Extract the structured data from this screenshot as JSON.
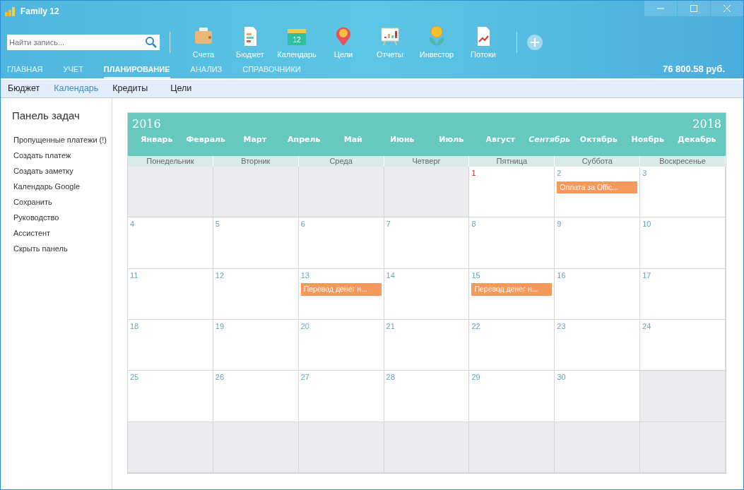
{
  "window": {
    "title": "Family 12"
  },
  "search": {
    "placeholder": "Найти запись..."
  },
  "toolbar": [
    {
      "label": "Счета",
      "kind": "wallet"
    },
    {
      "label": "Бюджет",
      "kind": "budget"
    },
    {
      "label": "Календарь",
      "kind": "calendar",
      "badge": "12"
    },
    {
      "label": "Цели",
      "kind": "goal"
    },
    {
      "label": "Отчеты",
      "kind": "reports"
    },
    {
      "label": "Инвестор",
      "kind": "investor"
    },
    {
      "label": "Потоки",
      "kind": "flows"
    }
  ],
  "main_tabs": [
    {
      "label": "ГЛАВНАЯ",
      "selected": false
    },
    {
      "label": "УЧЕТ",
      "selected": false
    },
    {
      "label": "ПЛАНИРОВАНИЕ",
      "selected": true
    },
    {
      "label": "АНАЛИЗ",
      "selected": false
    },
    {
      "label": "СПРАВОЧНИКИ",
      "selected": false
    }
  ],
  "balance": "76 800.58 руб.",
  "sub_tabs": [
    {
      "label": "Бюджет",
      "selected": false
    },
    {
      "label": "Календарь",
      "selected": true
    },
    {
      "label": "Кредиты",
      "selected": false
    },
    {
      "label": "Цели",
      "selected": false
    }
  ],
  "task_panel": {
    "title": "Панель задач",
    "items": [
      "Пропущенные платежи (!)",
      "Создать платеж",
      "Создать заметку",
      "Календарь Google",
      "Сохранить",
      "Руководство",
      "Ассистент",
      "Скрыть панель"
    ]
  },
  "calendar": {
    "year_prev": "2016",
    "year_next": "2018",
    "months": [
      {
        "label": "Январь",
        "selected": false
      },
      {
        "label": "Февраль",
        "selected": false
      },
      {
        "label": "Март",
        "selected": false
      },
      {
        "label": "Апрель",
        "selected": false
      },
      {
        "label": "Май",
        "selected": false
      },
      {
        "label": "Июнь",
        "selected": false
      },
      {
        "label": "Июль",
        "selected": false
      },
      {
        "label": "Август",
        "selected": false
      },
      {
        "label": "Сентябрь",
        "selected": true
      },
      {
        "label": "Октябрь",
        "selected": false
      },
      {
        "label": "Ноябрь",
        "selected": false
      },
      {
        "label": "Декабрь",
        "selected": false
      }
    ],
    "weekdays": [
      "Понедельник",
      "Вторник",
      "Среда",
      "Четверг",
      "Пятница",
      "Суббота",
      "Воскресенье"
    ],
    "weeks": [
      [
        {
          "in_month": false
        },
        {
          "in_month": false
        },
        {
          "in_month": false
        },
        {
          "in_month": false
        },
        {
          "in_month": true,
          "day": "1",
          "today": true
        },
        {
          "in_month": true,
          "day": "2",
          "today": false,
          "events": [
            "Оплата за Offic..."
          ]
        },
        {
          "in_month": true,
          "day": "3",
          "today": false
        }
      ],
      [
        {
          "in_month": true,
          "day": "4",
          "today": false
        },
        {
          "in_month": true,
          "day": "5",
          "today": false
        },
        {
          "in_month": true,
          "day": "6",
          "today": false
        },
        {
          "in_month": true,
          "day": "7",
          "today": false
        },
        {
          "in_month": true,
          "day": "8",
          "today": false
        },
        {
          "in_month": true,
          "day": "9",
          "today": false
        },
        {
          "in_month": true,
          "day": "10",
          "today": false
        }
      ],
      [
        {
          "in_month": true,
          "day": "11",
          "today": false
        },
        {
          "in_month": true,
          "day": "12",
          "today": false
        },
        {
          "in_month": true,
          "day": "13",
          "today": false,
          "events": [
            "Перевод денег н..."
          ]
        },
        {
          "in_month": true,
          "day": "14",
          "today": false
        },
        {
          "in_month": true,
          "day": "15",
          "today": false,
          "events": [
            "Перевод денег н..."
          ]
        },
        {
          "in_month": true,
          "day": "16",
          "today": false
        },
        {
          "in_month": true,
          "day": "17",
          "today": false
        }
      ],
      [
        {
          "in_month": true,
          "day": "18",
          "today": false
        },
        {
          "in_month": true,
          "day": "19",
          "today": false
        },
        {
          "in_month": true,
          "day": "20",
          "today": false
        },
        {
          "in_month": true,
          "day": "21",
          "today": false
        },
        {
          "in_month": true,
          "day": "22",
          "today": false
        },
        {
          "in_month": true,
          "day": "23",
          "today": false
        },
        {
          "in_month": true,
          "day": "24",
          "today": false
        }
      ],
      [
        {
          "in_month": true,
          "day": "25",
          "today": false
        },
        {
          "in_month": true,
          "day": "26",
          "today": false
        },
        {
          "in_month": true,
          "day": "27",
          "today": false
        },
        {
          "in_month": true,
          "day": "28",
          "today": false
        },
        {
          "in_month": true,
          "day": "29",
          "today": false
        },
        {
          "in_month": true,
          "day": "30",
          "today": false
        },
        {
          "in_month": false
        }
      ],
      [
        {
          "in_month": false
        },
        {
          "in_month": false
        },
        {
          "in_month": false
        },
        {
          "in_month": false
        },
        {
          "in_month": false
        },
        {
          "in_month": false
        },
        {
          "in_month": false
        }
      ]
    ]
  }
}
